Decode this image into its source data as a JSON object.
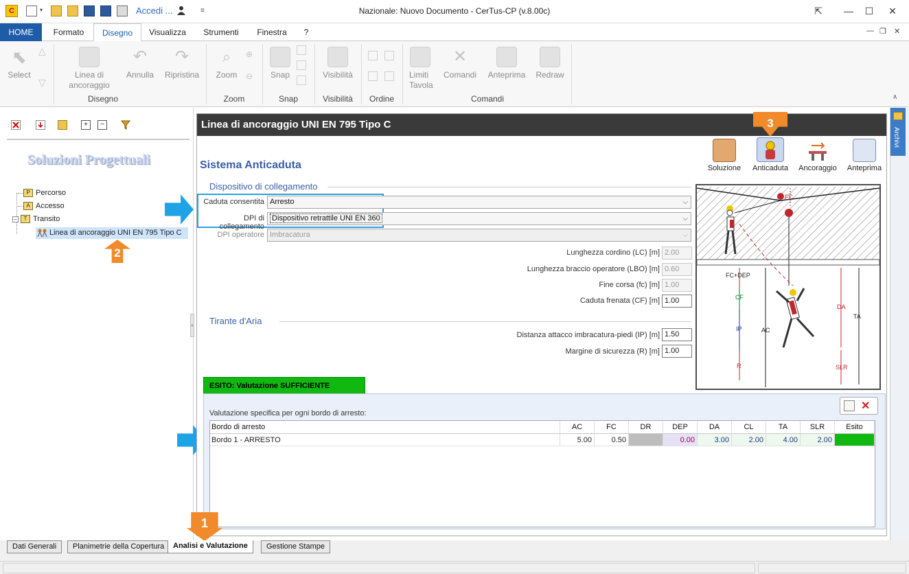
{
  "window": {
    "title": "Nazionale: Nuovo Documento - CerTus-CP (v.8.00c)",
    "accedi": "Accedi ...",
    "dropdown_glyph": "▾"
  },
  "menu": {
    "tabs": [
      "HOME",
      "Formato",
      "Disegno",
      "Visualizza",
      "Strumenti",
      "Finestra",
      "?"
    ]
  },
  "ribbon": {
    "buttons": {
      "select": "Select",
      "linea": "Linea di\nancoraggio",
      "annulla": "Annulla",
      "ripristina": "Ripristina",
      "zoom": "Zoom",
      "snap": "Snap",
      "visibilita": "Visibilità",
      "limiti": "Limiti\nTavola",
      "comandi": "Comandi",
      "anteprima": "Anteprima",
      "redraw": "Redraw"
    },
    "groups": {
      "disegno": "Disegno",
      "zoom": "Zoom",
      "snap": "Snap",
      "visibilita": "Visibilità",
      "ordine": "Ordine",
      "comandi": "Comandi"
    }
  },
  "left": {
    "title": "Soluzioni Progettuali",
    "tree": [
      {
        "label": "Percorso",
        "icon_letter": "P"
      },
      {
        "label": "Accesso",
        "icon_letter": "A"
      },
      {
        "label": "Transito",
        "icon_letter": "T"
      },
      {
        "label": "Linea di ancoraggio UNI EN 795 Tipo C",
        "icon_letter": ""
      }
    ]
  },
  "main": {
    "header": "Linea di ancoraggio UNI EN 795 Tipo C",
    "section": "Sistema Anticaduta",
    "toolbar": [
      "Soluzione",
      "Anticaduta",
      "Ancoraggio",
      "Anteprima"
    ],
    "dispositivo": {
      "title": "Dispositivo di collegamento",
      "caduta_label": "Caduta consentita",
      "caduta_value": "Arresto",
      "dpi_coll_label": "DPI di collegamento",
      "dpi_coll_value": "Dispositivo retrattile UNI EN 360",
      "dpi_op_label": "DPI operatore",
      "dpi_op_value": "Imbracatura"
    },
    "fields": [
      {
        "label": "Lunghezza cordino (LC) [m]",
        "value": "2.00",
        "disabled": true
      },
      {
        "label": "Lunghezza braccio operatore (LBO) [m]",
        "value": "0.60",
        "disabled": true
      },
      {
        "label": "Fine corsa (fc) [m]",
        "value": "1.00",
        "disabled": true
      },
      {
        "label": "Caduta frenata (CF) [m]",
        "value": "1.00",
        "disabled": false
      }
    ],
    "tirante": {
      "title": "Tirante d'Aria",
      "ip_label": "Distanza attacco imbracatura-piedi (IP) [m]",
      "ip_value": "1.50",
      "r_label": "Margine di sicurezza (R) [m]",
      "r_value": "1.00"
    },
    "diagram_labels": {
      "fc": "FC",
      "fcdep": "FC+DEP",
      "cf": "CF",
      "ip": "IP",
      "r": "R",
      "ac": "AC",
      "da": "DA",
      "slr": "SLR",
      "ta": "TA"
    },
    "esito": {
      "tab": "ESITO:  Valutazione SUFFICIENTE",
      "caption": "Valutazione specifica per ogni bordo di arresto:",
      "columns": [
        "Bordo di arresto",
        "AC",
        "FC",
        "DR",
        "DEP",
        "DA",
        "CL",
        "TA",
        "SLR",
        "Esito"
      ],
      "rows": [
        [
          "Bordo 1 - ARRESTO",
          "5.00",
          "0.50",
          "",
          "0.00",
          "3.00",
          "2.00",
          "4.00",
          "2.00",
          ""
        ]
      ],
      "ok_color": "#10b810"
    }
  },
  "bottom_tabs": [
    "Dati Generali",
    "Planimetrie della Copertura",
    "Analisi e Valutazione",
    "Gestione Stampe"
  ],
  "right_panel": {
    "label": "Archivi"
  },
  "callouts": [
    "1",
    "2",
    "3"
  ],
  "colors": {
    "accent": "#1f5ca8",
    "callout": "#f08a2a",
    "highlight": "#2aa0e0",
    "success": "#10b810"
  }
}
